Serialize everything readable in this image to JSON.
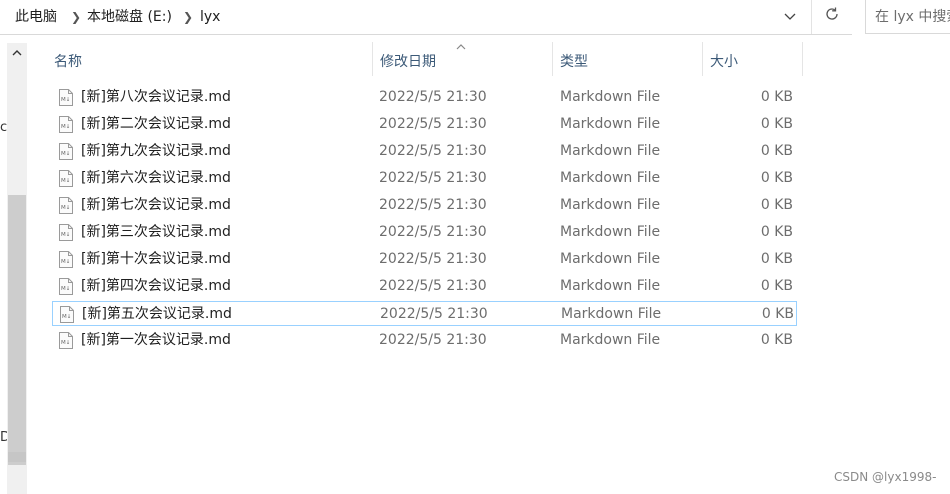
{
  "address_bar": {
    "crumbs": [
      "此电脑",
      "本地磁盘 (E:)",
      "lyx"
    ]
  },
  "search": {
    "placeholder": "在 lyx 中搜索"
  },
  "columns": {
    "name": "名称",
    "date": "修改日期",
    "type": "类型",
    "size": "大小"
  },
  "icons": {
    "sort": "sort-ascending-icon",
    "separator": "chevron-right-icon",
    "dropdown": "chevron-down-icon",
    "refresh": "refresh-icon",
    "file": "markdown-file-icon"
  },
  "files": [
    {
      "name": "[新]第八次会议记录.md",
      "date": "2022/5/5 21:30",
      "type": "Markdown File",
      "size": "0 KB"
    },
    {
      "name": "[新]第二次会议记录.md",
      "date": "2022/5/5 21:30",
      "type": "Markdown File",
      "size": "0 KB"
    },
    {
      "name": "[新]第九次会议记录.md",
      "date": "2022/5/5 21:30",
      "type": "Markdown File",
      "size": "0 KB"
    },
    {
      "name": "[新]第六次会议记录.md",
      "date": "2022/5/5 21:30",
      "type": "Markdown File",
      "size": "0 KB"
    },
    {
      "name": "[新]第七次会议记录.md",
      "date": "2022/5/5 21:30",
      "type": "Markdown File",
      "size": "0 KB"
    },
    {
      "name": "[新]第三次会议记录.md",
      "date": "2022/5/5 21:30",
      "type": "Markdown File",
      "size": "0 KB"
    },
    {
      "name": "[新]第十次会议记录.md",
      "date": "2022/5/5 21:30",
      "type": "Markdown File",
      "size": "0 KB"
    },
    {
      "name": "[新]第四次会议记录.md",
      "date": "2022/5/5 21:30",
      "type": "Markdown File",
      "size": "0 KB"
    },
    {
      "name": "[新]第五次会议记录.md",
      "date": "2022/5/5 21:30",
      "type": "Markdown File",
      "size": "0 KB",
      "selected": true
    },
    {
      "name": "[新]第一次会议记录.md",
      "date": "2022/5/5 21:30",
      "type": "Markdown File",
      "size": "0 KB"
    }
  ],
  "nav_pane": {
    "clipped_chars": [
      "c",
      "D"
    ]
  },
  "watermark": "CSDN @lyx1998-",
  "colors": {
    "header_text": "#3c5a78",
    "selection_border": "#99d1ff",
    "secondary_text": "#6d6d6d"
  }
}
